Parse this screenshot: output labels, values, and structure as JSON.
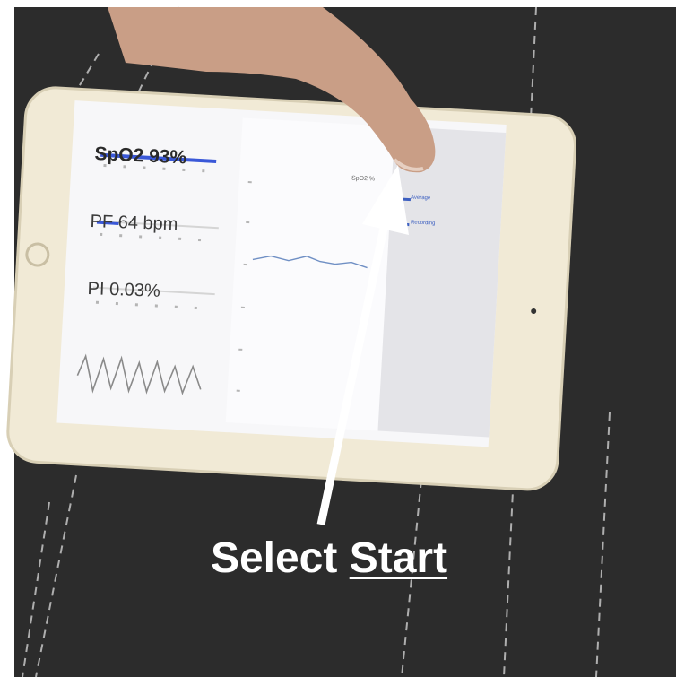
{
  "oximeter_app": {
    "spo2_reading": "SpO2 93%",
    "spo2_level_fraction": 0.95,
    "pr_reading": "PF 64 bpm",
    "pr_level_fraction": 0.18,
    "pi_reading": "PI 0.03%",
    "chart_title": "SpO2 %",
    "legend_items": [
      "Average",
      "Recording"
    ]
  },
  "instruction": {
    "lead": "Select",
    "target": "Start"
  },
  "colors": {
    "accent_blue": "#3a58d8",
    "ipad_body": "#f1ead6",
    "background": "#2c2c2c",
    "caption": "#ffffff"
  }
}
